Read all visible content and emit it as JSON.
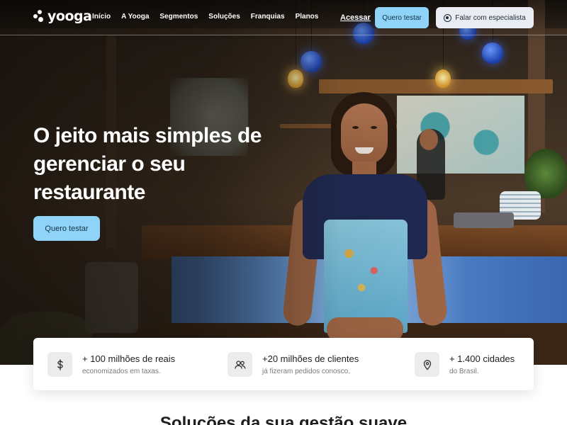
{
  "brand": {
    "name": "yooga"
  },
  "nav": {
    "links": [
      "Início",
      "A Yooga",
      "Segmentos",
      "Soluções",
      "Franquias",
      "Planos"
    ],
    "login": "Acessar",
    "try_button": "Quero testar",
    "expert_button": "Falar com especialista",
    "expert_icon": "whatsapp-icon"
  },
  "hero": {
    "headline": "O jeito mais simples de gerenciar o seu restaurante",
    "cta": "Quero testar"
  },
  "stats": [
    {
      "icon": "dollar-icon",
      "title": "+ 100 milhões de reais",
      "subtitle": "economizados em taxas."
    },
    {
      "icon": "users-icon",
      "title": "+20 milhões de clientes",
      "subtitle": "já fizeram pedidos conosco."
    },
    {
      "icon": "map-pin-icon",
      "title": "+ 1.400 cidades",
      "subtitle": "do Brasil."
    }
  ],
  "section": {
    "title": "Soluções da sua gestão suave"
  },
  "colors": {
    "accent": "#8fd3f8",
    "secondary_button": "#e9edf3",
    "text_dark": "#1e1e1e"
  }
}
